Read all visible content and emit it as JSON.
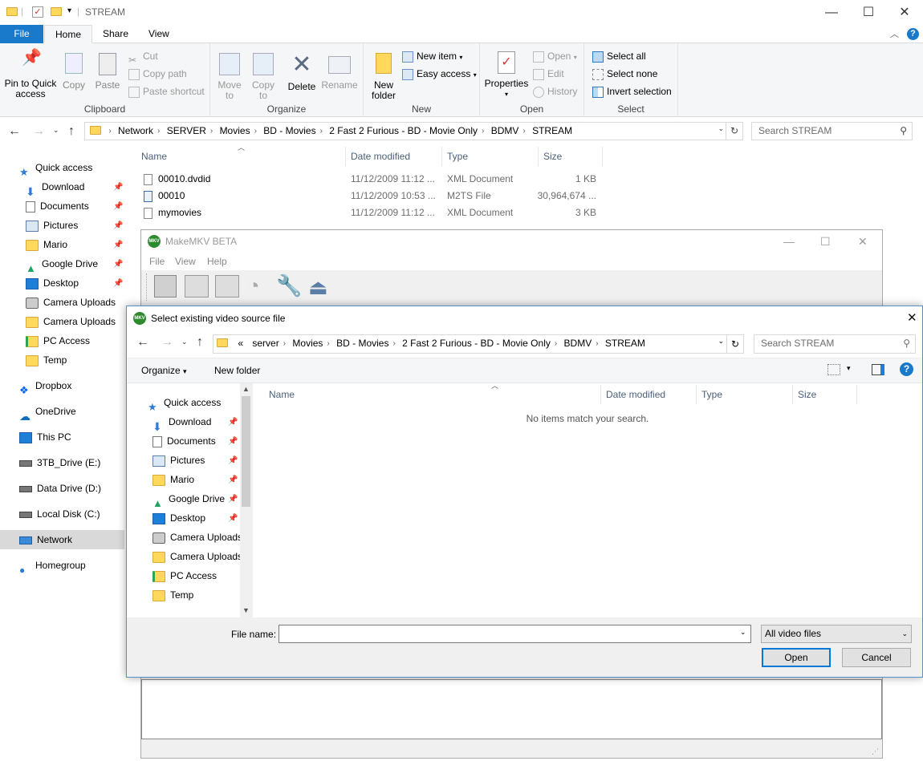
{
  "explorer": {
    "title": "STREAM",
    "ribbon_tabs": [
      "File",
      "Home",
      "Share",
      "View"
    ],
    "clipboard": {
      "pin": "Pin to Quick access",
      "copy": "Copy",
      "paste": "Paste",
      "cut": "Cut",
      "copy_path": "Copy path",
      "paste_shortcut": "Paste shortcut",
      "label": "Clipboard"
    },
    "organize": {
      "move_to": "Move to",
      "copy_to": "Copy to",
      "delete": "Delete",
      "rename": "Rename",
      "label": "Organize"
    },
    "new": {
      "new_folder": "New folder",
      "new_item": "New item",
      "easy_access": "Easy access",
      "label": "New"
    },
    "open": {
      "properties": "Properties",
      "open": "Open",
      "edit": "Edit",
      "history": "History",
      "label": "Open"
    },
    "select": {
      "select_all": "Select all",
      "select_none": "Select none",
      "invert": "Invert selection",
      "label": "Select"
    },
    "breadcrumb": [
      "Network",
      "SERVER",
      "Movies",
      "BD - Movies",
      "2 Fast 2 Furious - BD - Movie Only",
      "BDMV",
      "STREAM"
    ],
    "search_placeholder": "Search STREAM",
    "nav": [
      {
        "label": "Quick access"
      },
      {
        "label": "Download"
      },
      {
        "label": "Documents"
      },
      {
        "label": "Pictures"
      },
      {
        "label": "Mario"
      },
      {
        "label": "Google Drive"
      },
      {
        "label": "Desktop"
      },
      {
        "label": "Camera Uploads"
      },
      {
        "label": "Camera Uploads"
      },
      {
        "label": "PC Access"
      },
      {
        "label": "Temp"
      },
      {
        "label": "Dropbox"
      },
      {
        "label": "OneDrive"
      },
      {
        "label": "This PC"
      },
      {
        "label": "3TB_Drive (E:)"
      },
      {
        "label": "Data Drive (D:)"
      },
      {
        "label": "Local Disk (C:)"
      },
      {
        "label": "Network"
      },
      {
        "label": "Homegroup"
      }
    ],
    "columns": [
      "Name",
      "Date modified",
      "Type",
      "Size"
    ],
    "files": [
      {
        "name": "00010.dvdid",
        "date": "11/12/2009 11:12 ...",
        "type": "XML Document",
        "size": "1 KB"
      },
      {
        "name": "00010",
        "date": "11/12/2009 10:53 ...",
        "type": "M2TS File",
        "size": "30,964,674 ..."
      },
      {
        "name": "mymovies",
        "date": "11/12/2009 11:12 ...",
        "type": "XML Document",
        "size": "3 KB"
      }
    ]
  },
  "makemkv": {
    "title": "MakeMKV BETA",
    "menu": [
      "File",
      "View",
      "Help"
    ]
  },
  "dialog": {
    "title": "Select existing video source file",
    "breadcrumb": [
      "server",
      "Movies",
      "BD - Movies",
      "2 Fast 2 Furious - BD - Movie Only",
      "BDMV",
      "STREAM"
    ],
    "overflow": "«",
    "search_placeholder": "Search STREAM",
    "organize": "Organize",
    "new_folder": "New folder",
    "nav": [
      {
        "label": "Quick access"
      },
      {
        "label": "Download"
      },
      {
        "label": "Documents"
      },
      {
        "label": "Pictures"
      },
      {
        "label": "Mario"
      },
      {
        "label": "Google Drive"
      },
      {
        "label": "Desktop"
      },
      {
        "label": "Camera Uploads"
      },
      {
        "label": "Camera Uploads"
      },
      {
        "label": "PC Access"
      },
      {
        "label": "Temp"
      }
    ],
    "columns": [
      "Name",
      "Date modified",
      "Type",
      "Size"
    ],
    "empty_message": "No items match your search.",
    "file_name_label": "File name:",
    "file_name_value": "",
    "filter": "All video files",
    "open_button": "Open",
    "cancel_button": "Cancel"
  },
  "colors": {
    "file_tab": "#1979ca",
    "selection": "#cce8ff",
    "network_selected": "#d9d9d9",
    "dialog_border": "#5a8fc7"
  }
}
